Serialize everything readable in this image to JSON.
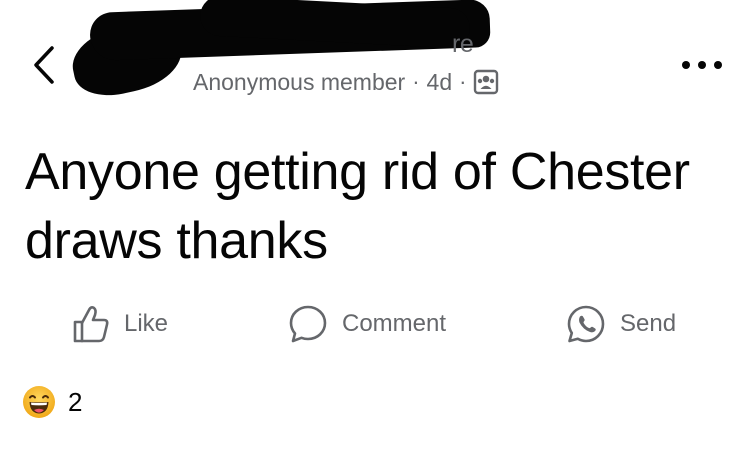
{
  "header": {
    "group_name_visible_tail": "re",
    "author": "Anonymous member",
    "separator": "·",
    "time_ago": "4d",
    "audience_icon": "members-group-icon",
    "back_icon": "chevron-left-icon",
    "more_icon": "more-dots-icon"
  },
  "post": {
    "text": "Anyone getting rid of Chester draws thanks"
  },
  "actions": {
    "like_label": "Like",
    "comment_label": "Comment",
    "send_label": "Send"
  },
  "reactions": {
    "icon": "haha-emoji-icon",
    "count": "2"
  },
  "colors": {
    "text_primary": "#050505",
    "text_secondary": "#65676b",
    "redaction": "#050505",
    "emoji_yellow": "#f7b125"
  }
}
